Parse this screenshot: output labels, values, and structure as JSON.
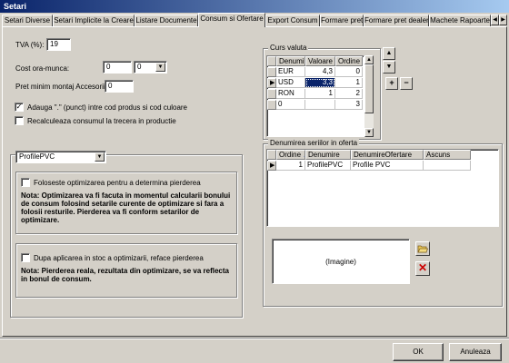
{
  "window": {
    "title": "Setari"
  },
  "tabs": [
    "Setari Diverse",
    "Setari Implicite la Creare",
    "Listare Documente",
    "Consum si Ofertare",
    "Export Consum",
    "Formare pret",
    "Formare pret dealer",
    "Machete Rapoarte"
  ],
  "active_tab": "Consum si Ofertare",
  "form": {
    "tva_label": "TVA (%):",
    "tva_value": "19",
    "cost_label": "Cost ora-munca:",
    "cost_value": "0",
    "cost_combo_value": "0",
    "pret_label": "Pret minim montaj Accesorii:",
    "pret_value": "0",
    "chk_adauga_label": "Adauga \".\" (punct) intre cod produs si cod culoare",
    "chk_adauga_checked": true,
    "chk_recalc_label": "Recalculeaza consumul la trecera in productie",
    "chk_recalc_checked": false
  },
  "profile": {
    "combo_value": "ProfilePVC",
    "opt1_label": "Foloseste optimizarea pentru a determina pierderea",
    "opt1_note": "Nota: Optimizarea va fi facuta in momentul calcularii bonului de consum folosind setarile curente de optimizare si fara a folosii resturile. Pierderea va fi conform setarilor de optimizare.",
    "opt2_label": "Dupa aplicarea in stoc a optimizarii, reface pierderea",
    "opt2_note": "Nota: Pierderea reala, rezultata din optimizare, se va reflecta in bonul de consum."
  },
  "curs": {
    "title": "Curs valuta",
    "columns": [
      "Denumire",
      "Valoare",
      "Ordine"
    ],
    "rows": [
      {
        "denumire": "EUR",
        "valoare": "4,3",
        "ordine": "0"
      },
      {
        "denumire": "USD",
        "valoare": "3,3",
        "ordine": "1"
      },
      {
        "denumire": "RON",
        "valoare": "1",
        "ordine": "2"
      },
      {
        "denumire": "0",
        "valoare": "",
        "ordine": "3"
      }
    ],
    "add_label": "+",
    "remove_label": "−"
  },
  "serii": {
    "title": "Denumirea seriilor in oferta",
    "columns": [
      "Ordine",
      "Denumire",
      "DenumireOfertare",
      "Ascuns"
    ],
    "rows": [
      {
        "ordine": "1",
        "denumire": "ProfilePVC",
        "ofertare": "Profile PVC",
        "ascuns": ""
      }
    ],
    "image_placeholder": "(Imagine)"
  },
  "buttons": {
    "ok": "OK",
    "cancel": "Anuleaza"
  },
  "icons": {
    "up": "arrow-up-icon",
    "down": "arrow-down-icon",
    "open": "folder-open-icon",
    "delete": "delete-x-icon"
  },
  "colors": {
    "titlebar": "#0a246a",
    "selection": "#0a246a",
    "face": "#d4d0c8",
    "delete_red": "#cc0000"
  }
}
